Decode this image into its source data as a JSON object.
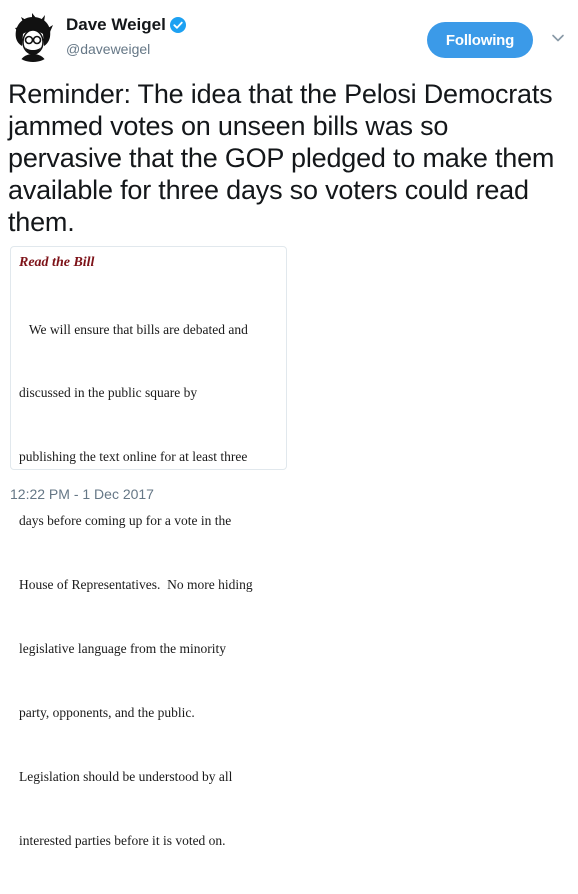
{
  "author": {
    "display_name": "Dave Weigel",
    "handle": "@daveweigel",
    "verified": true,
    "avatar_icon": "caricature-avatar"
  },
  "follow_button": {
    "label": "Following",
    "color": "#3b9ae8"
  },
  "menu_icon": "chevron-down-icon",
  "tweet_text": "Reminder: The idea that the Pelosi Democrats jammed votes on unseen bills was so pervasive that the GOP pledged to make them available for three days so voters could read them.",
  "card": {
    "title": "Read the Bill",
    "title_color": "#7d1218",
    "lines": [
      "   We will ensure that bills are debated and",
      "discussed in the public square by",
      "publishing the text online for at least three",
      "days before coming up for a vote in the",
      "House of Representatives.  No more hiding",
      "legislative language from the minority",
      "party, opponents, and the public.",
      "Legislation should be understood by all",
      "interested parties before it is voted on."
    ]
  },
  "timestamp": "12:22 PM - 1 Dec 2017"
}
